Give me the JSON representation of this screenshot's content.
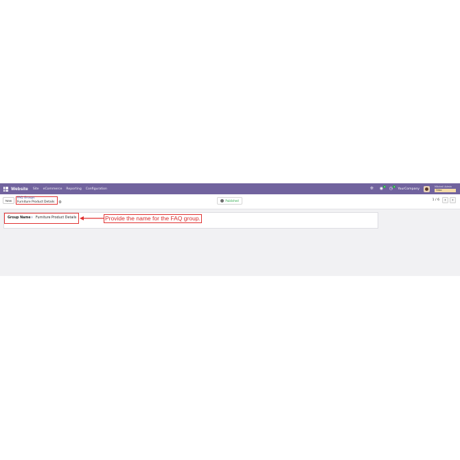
{
  "navbar": {
    "brand": "Website",
    "menu": [
      "Site",
      "eCommerce",
      "Reporting",
      "Configuration"
    ],
    "icons": [
      "apps-grid-icon",
      "bug-icon",
      "chat-icon",
      "clock-icon"
    ],
    "chat_badge": "1",
    "activity_badge": "1",
    "company": "YourCompany",
    "user_name": "Mitchell Admin",
    "database": "Odoo"
  },
  "control_panel": {
    "new_label": "New",
    "breadcrumb_parent": "FAQ Groups",
    "breadcrumb_current": "Furniture Product Details",
    "published_label": "Published",
    "pager": "1 / 6"
  },
  "form": {
    "group_name_label": "Group Name",
    "help_marker": "?",
    "group_name_value": "Furniture Product Details"
  },
  "annotation": {
    "text": "Provide the name for the FAQ group.",
    "color": "#d62b2b"
  },
  "colors": {
    "navbar": "#71639e",
    "published": "#27a745",
    "link": "#3f4f9a"
  }
}
